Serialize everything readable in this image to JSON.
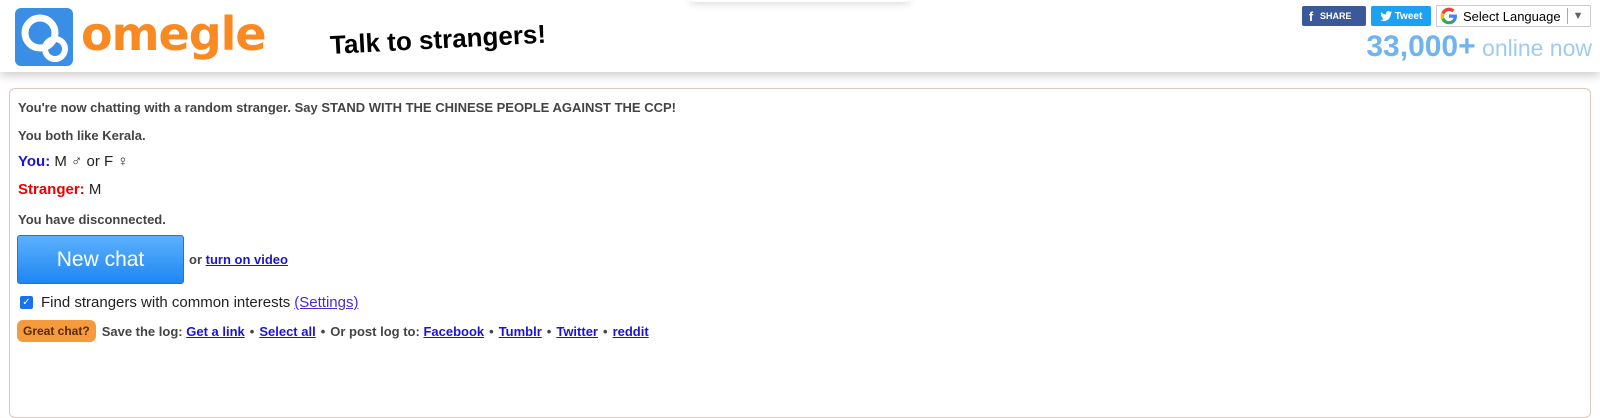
{
  "header": {
    "logo_text": "omegle",
    "tagline": "Talk to strangers!",
    "share_facebook": "SHARE",
    "share_twitter": "Tweet",
    "language_select": "Select Language",
    "online_count": "33,000+",
    "online_suffix": "online now"
  },
  "chat": {
    "intro": "You're now chatting with a random stranger. Say STAND WITH THE CHINESE PEOPLE AGAINST THE CCP!",
    "common_interest": "You both like Kerala.",
    "messages": [
      {
        "sender": "You:",
        "text": "M ♂ or F ♀"
      },
      {
        "sender": "Stranger:",
        "text": "M"
      }
    ],
    "disconnect_notice": "You have disconnected.",
    "new_chat_button": "New chat",
    "or_text": "or",
    "video_link": "turn on video",
    "interests_label": "Find strangers with common interests",
    "interests_checked": true,
    "settings_link": "(Settings)",
    "great_chat_button": "Great chat?",
    "save_log_label": "Save the log:",
    "get_link": "Get a link",
    "select_all": "Select all",
    "post_log_label": "Or post log to:",
    "post_targets": [
      "Facebook",
      "Tumblr",
      "Twitter",
      "reddit"
    ]
  },
  "colors": {
    "brand_orange": "#f98a21",
    "you_label": "#1b14d8",
    "stranger_label": "#ee0000",
    "new_chat_blue": "#1f86f3",
    "online_blue": "#6fb3ef"
  }
}
